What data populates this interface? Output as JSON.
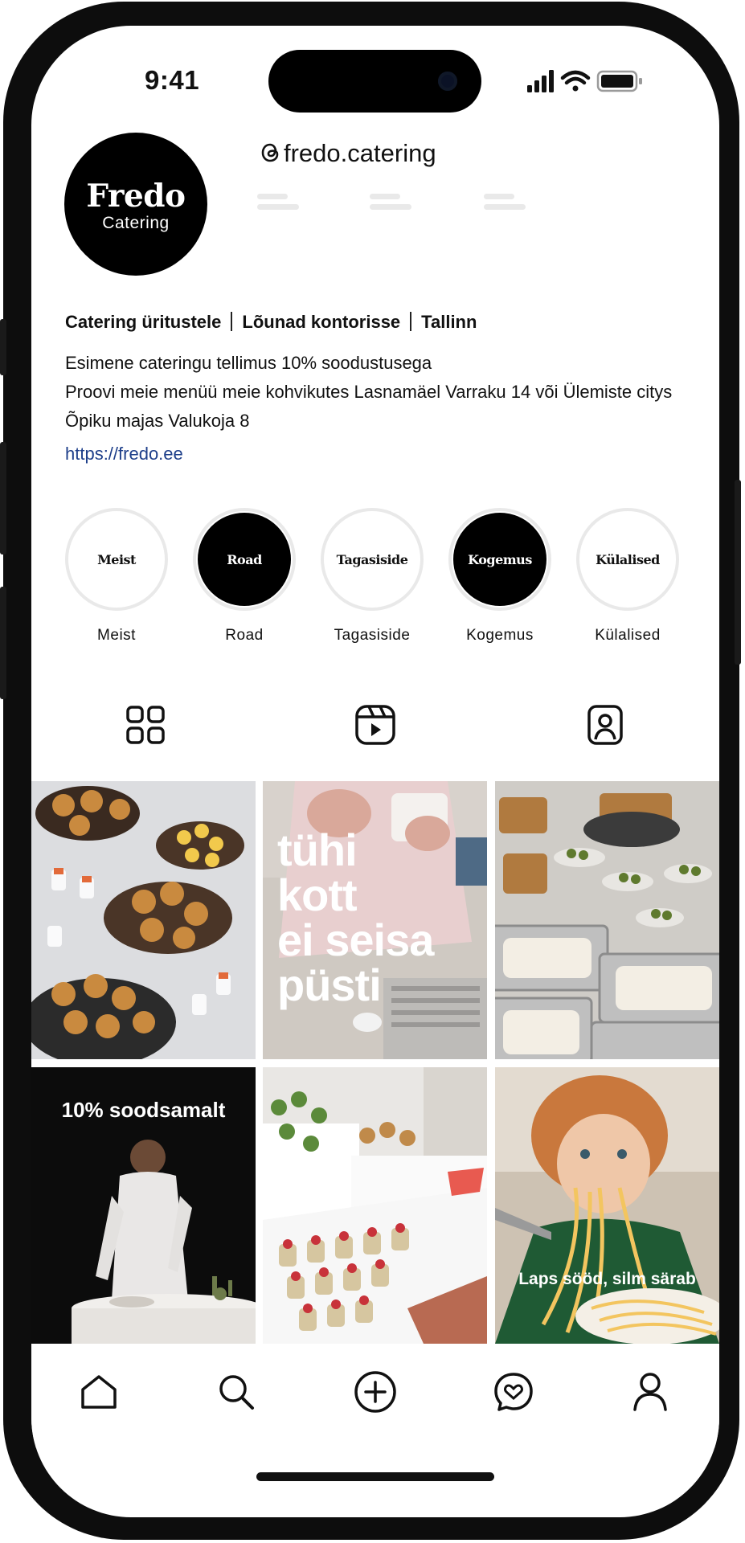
{
  "status_bar": {
    "time": "9:41"
  },
  "profile": {
    "avatar_line1": "Fredo",
    "avatar_line2": "Catering",
    "handle": "fredo.catering",
    "bio_tags": [
      "Catering üritustele",
      "Lõunad kontorisse",
      "Tallinn"
    ],
    "bio_lines": [
      "Esimene cateringu tellimus 10% soodustusega",
      "Proovi meie menüü meie kohvikutes Lasnamäel Varraku 14 või Ülemiste citys Õpiku majas Valukoja 8"
    ],
    "link": "https://fredo.ee"
  },
  "highlights": [
    {
      "inner": "Meist",
      "caption": "Meist",
      "style": "white"
    },
    {
      "inner": "Road",
      "caption": "Road",
      "style": "black"
    },
    {
      "inner": "Tagasiside",
      "caption": "Tagasiside",
      "style": "white"
    },
    {
      "inner": "Kogemus",
      "caption": "Kogemus",
      "style": "black"
    },
    {
      "inner": "Külalised",
      "caption": "Külalised",
      "style": "white"
    }
  ],
  "tabs": [
    "grid-icon",
    "reels-icon",
    "tagged-icon"
  ],
  "posts": [
    {
      "name": "post-burgers",
      "text": ""
    },
    {
      "name": "post-tyhi-kott",
      "text": [
        "tühi",
        "kott",
        "ei seisa",
        "püsti"
      ]
    },
    {
      "name": "post-buffet-silver",
      "text": ""
    },
    {
      "name": "post-soodsamalt",
      "text": "10% soodsamalt"
    },
    {
      "name": "post-dessert-table",
      "text": ""
    },
    {
      "name": "post-laps-sood",
      "text": "Laps sööd, silm särab"
    }
  ],
  "bottom_nav": [
    "home-icon",
    "search-icon",
    "create-icon",
    "messages-icon",
    "profile-icon"
  ],
  "colors": {
    "link": "#1e3f8a",
    "accent_black": "#000000",
    "placeholder_gray": "#e9e9e9"
  }
}
